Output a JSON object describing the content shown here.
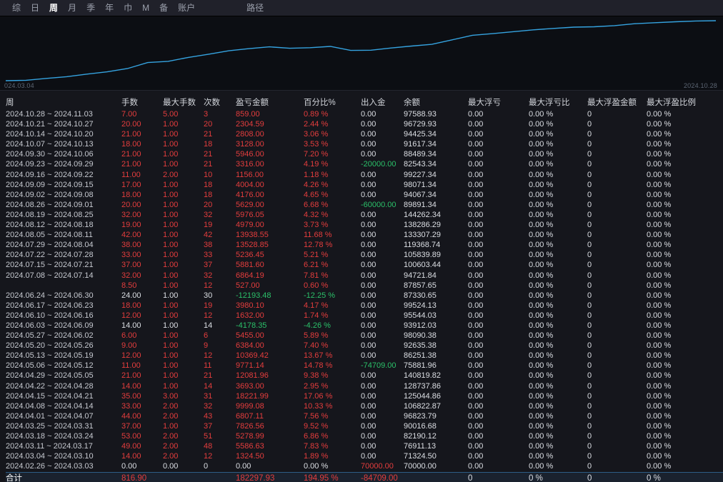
{
  "menu": {
    "items": [
      {
        "label": "综",
        "selected": false
      },
      {
        "label": "日",
        "selected": false
      },
      {
        "label": "周",
        "selected": true
      },
      {
        "label": "月",
        "selected": false
      },
      {
        "label": "季",
        "selected": false
      },
      {
        "label": "年",
        "selected": false
      },
      {
        "label": "巾",
        "selected": false
      },
      {
        "label": "M",
        "selected": false
      },
      {
        "label": "备",
        "selected": false
      },
      {
        "label": "账户",
        "selected": false
      },
      {
        "label": "路径",
        "selected": false,
        "gap_before": true
      }
    ]
  },
  "chart": {
    "left_label": "024.03.04",
    "right_label": "2024.10.28"
  },
  "chart_data": {
    "type": "line",
    "title": "",
    "x_axis_labels": [
      "024.03.04",
      "2024.10.28"
    ],
    "ylim": [
      0,
      182297.93
    ],
    "series_name": "cumulative_pnl",
    "cumulative_pnl": [
      0,
      1324.5,
      6911.13,
      12190.12,
      20016.68,
      26823.79,
      36822.87,
      55044.86,
      58737.86,
      70819.82,
      80590.96,
      90960.38,
      97344.38,
      102799.38,
      98621.03,
      100253.03,
      104233.13,
      92039.65,
      92566.65,
      99430.84,
      105312.44,
      110548.89,
      124077.74,
      138016.29,
      142995.29,
      148971.34,
      154600.34,
      158776.34,
      162780.34,
      163936.34,
      167252.34,
      173198.34,
      176326.34,
      179134.34,
      181438.93,
      182297.93
    ]
  },
  "colors": {
    "accent_line": "#35a3e0",
    "tone_map": {
      "r": "#e43d3d",
      "g": "#2bc069",
      "w": "#dcdfe4",
      "n": "#aaaeb8",
      "-": "transparent"
    }
  },
  "table": {
    "headers": [
      "周",
      "手数",
      "最大手数",
      "次数",
      "盈亏金额",
      "百分比%",
      "出入金",
      "余额",
      "最大浮亏",
      "最大浮亏比",
      "最大浮盈金额",
      "最大浮盈比例"
    ],
    "column_keys": [
      "lots",
      "max-lots",
      "times",
      "pnl",
      "pct",
      "cash-flow",
      "balance",
      "max-float-loss",
      "max-float-loss-pct",
      "max-float-profit",
      "max-float-profit-pct"
    ],
    "rows": [
      {
        "week": "2024.10.28 ~ 2024.11.03",
        "vals": [
          "7.00",
          "5.00",
          "3",
          "859.00",
          "0.89 %",
          "0.00",
          "97588.93",
          "0.00",
          "0.00 %",
          "0",
          "0.00 %"
        ],
        "tones": "rrrrrwwwwww"
      },
      {
        "week": "2024.10.21 ~ 2024.10.27",
        "vals": [
          "20.00",
          "1.00",
          "20",
          "2304.59",
          "2.44 %",
          "0.00",
          "96729.93",
          "0.00",
          "0.00 %",
          "0",
          "0.00 %"
        ],
        "tones": "rrrrrwwwwww"
      },
      {
        "week": "2024.10.14 ~ 2024.10.20",
        "vals": [
          "21.00",
          "1.00",
          "21",
          "2808.00",
          "3.06 %",
          "0.00",
          "94425.34",
          "0.00",
          "0.00 %",
          "0",
          "0.00 %"
        ],
        "tones": "rrrrrwwwwww"
      },
      {
        "week": "2024.10.07 ~ 2024.10.13",
        "vals": [
          "18.00",
          "1.00",
          "18",
          "3128.00",
          "3.53 %",
          "0.00",
          "91617.34",
          "0.00",
          "0.00 %",
          "0",
          "0.00 %"
        ],
        "tones": "rrrrrwwwwww"
      },
      {
        "week": "2024.09.30 ~ 2024.10.06",
        "vals": [
          "21.00",
          "1.00",
          "21",
          "5946.00",
          "7.20 %",
          "0.00",
          "88489.34",
          "0.00",
          "0.00 %",
          "0",
          "0.00 %"
        ],
        "tones": "rrrrrwwwwww"
      },
      {
        "week": "2024.09.23 ~ 2024.09.29",
        "vals": [
          "21.00",
          "1.00",
          "21",
          "3316.00",
          "4.19 %",
          "-20000.00",
          "82543.34",
          "0.00",
          "0.00 %",
          "0",
          "0.00 %"
        ],
        "tones": "rrrrrgwwwww"
      },
      {
        "week": "2024.09.16 ~ 2024.09.22",
        "vals": [
          "11.00",
          "2.00",
          "10",
          "1156.00",
          "1.18 %",
          "0.00",
          "99227.34",
          "0.00",
          "0.00 %",
          "0",
          "0.00 %"
        ],
        "tones": "rrrrrwwwwww"
      },
      {
        "week": "2024.09.09 ~ 2024.09.15",
        "vals": [
          "17.00",
          "1.00",
          "18",
          "4004.00",
          "4.26 %",
          "0.00",
          "98071.34",
          "0.00",
          "0.00 %",
          "0",
          "0.00 %"
        ],
        "tones": "rrrrrwwwwww"
      },
      {
        "week": "2024.09.02 ~ 2024.09.08",
        "vals": [
          "18.00",
          "1.00",
          "18",
          "4176.00",
          "4.65 %",
          "0.00",
          "94067.34",
          "0.00",
          "0.00 %",
          "0",
          "0.00 %"
        ],
        "tones": "rrrrrwwwwww"
      },
      {
        "week": "2024.08.26 ~ 2024.09.01",
        "vals": [
          "20.00",
          "1.00",
          "20",
          "5629.00",
          "6.68 %",
          "-60000.00",
          "89891.34",
          "0.00",
          "0.00 %",
          "0",
          "0.00 %"
        ],
        "tones": "rrrrrgwwwww"
      },
      {
        "week": "2024.08.19 ~ 2024.08.25",
        "vals": [
          "32.00",
          "1.00",
          "32",
          "5976.05",
          "4.32 %",
          "0.00",
          "144262.34",
          "0.00",
          "0.00 %",
          "0",
          "0.00 %"
        ],
        "tones": "rrrrrwwwwww"
      },
      {
        "week": "2024.08.12 ~ 2024.08.18",
        "vals": [
          "19.00",
          "1.00",
          "19",
          "4979.00",
          "3.73 %",
          "0.00",
          "138286.29",
          "0.00",
          "0.00 %",
          "0",
          "0.00 %"
        ],
        "tones": "rrrrrwwwwww"
      },
      {
        "week": "2024.08.05 ~ 2024.08.11",
        "vals": [
          "42.00",
          "1.00",
          "42",
          "13938.55",
          "11.68 %",
          "0.00",
          "133307.29",
          "0.00",
          "0.00 %",
          "0",
          "0.00 %"
        ],
        "tones": "rrrrrwwwwww"
      },
      {
        "week": "2024.07.29 ~ 2024.08.04",
        "vals": [
          "38.00",
          "1.00",
          "38",
          "13528.85",
          "12.78 %",
          "0.00",
          "119368.74",
          "0.00",
          "0.00 %",
          "0",
          "0.00 %"
        ],
        "tones": "rrrrrwwwwww"
      },
      {
        "week": "2024.07.22 ~ 2024.07.28",
        "vals": [
          "33.00",
          "1.00",
          "33",
          "5236.45",
          "5.21 %",
          "0.00",
          "105839.89",
          "0.00",
          "0.00 %",
          "0",
          "0.00 %"
        ],
        "tones": "rrrrrwwwwww"
      },
      {
        "week": "2024.07.15 ~ 2024.07.21",
        "vals": [
          "37.00",
          "1.00",
          "37",
          "5881.60",
          "6.21 %",
          "0.00",
          "100603.44",
          "0.00",
          "0.00 %",
          "0",
          "0.00 %"
        ],
        "tones": "rrrrrwwwwww"
      },
      {
        "week": "2024.07.08 ~ 2024.07.14",
        "vals": [
          "32.00",
          "1.00",
          "32",
          "6864.19",
          "7.81 %",
          "0.00",
          "94721.84",
          "0.00",
          "0.00 %",
          "0",
          "0.00 %"
        ],
        "tones": "rrrrrwwwwww"
      },
      {
        "week": "",
        "vals": [
          "8.50",
          "1.00",
          "12",
          "527.00",
          "0.60 %",
          "0.00",
          "87857.65",
          "0.00",
          "0.00 %",
          "0",
          "0.00 %"
        ],
        "tones": "rrrrrwwwwww"
      },
      {
        "week": "2024.06.24 ~ 2024.06.30",
        "vals": [
          "24.00",
          "1.00",
          "30",
          "-12193.48",
          "-12.25 %",
          "0.00",
          "87330.65",
          "0.00",
          "0.00 %",
          "0",
          "0.00 %"
        ],
        "tones": "wwwggwwwwww"
      },
      {
        "week": "2024.06.17 ~ 2024.06.23",
        "vals": [
          "18.00",
          "1.00",
          "19",
          "3980.10",
          "4.17 %",
          "0.00",
          "99524.13",
          "0.00",
          "0.00 %",
          "0",
          "0.00 %"
        ],
        "tones": "rrrrrwwwwww"
      },
      {
        "week": "2024.06.10 ~ 2024.06.16",
        "vals": [
          "12.00",
          "1.00",
          "12",
          "1632.00",
          "1.74 %",
          "0.00",
          "95544.03",
          "0.00",
          "0.00 %",
          "0",
          "0.00 %"
        ],
        "tones": "rrrrrwwwwww"
      },
      {
        "week": "2024.06.03 ~ 2024.06.09",
        "vals": [
          "14.00",
          "1.00",
          "14",
          "-4178.35",
          "-4.26 %",
          "0.00",
          "93912.03",
          "0.00",
          "0.00 %",
          "0",
          "0.00 %"
        ],
        "tones": "wwwggwwwwww"
      },
      {
        "week": "2024.05.27 ~ 2024.06.02",
        "vals": [
          "6.00",
          "1.00",
          "6",
          "5455.00",
          "5.89 %",
          "0.00",
          "98090.38",
          "0.00",
          "0.00 %",
          "0",
          "0.00 %"
        ],
        "tones": "rrrrrwwwwww"
      },
      {
        "week": "2024.05.20 ~ 2024.05.26",
        "vals": [
          "9.00",
          "1.00",
          "9",
          "6384.00",
          "7.40 %",
          "0.00",
          "92635.38",
          "0.00",
          "0.00 %",
          "0",
          "0.00 %"
        ],
        "tones": "rrrrrwwwwww"
      },
      {
        "week": "2024.05.13 ~ 2024.05.19",
        "vals": [
          "12.00",
          "1.00",
          "12",
          "10369.42",
          "13.67 %",
          "0.00",
          "86251.38",
          "0.00",
          "0.00 %",
          "0",
          "0.00 %"
        ],
        "tones": "rrrrrwwwwww"
      },
      {
        "week": "2024.05.06 ~ 2024.05.12",
        "vals": [
          "11.00",
          "1.00",
          "11",
          "9771.14",
          "14.78 %",
          "-74709.00",
          "75881.96",
          "0.00",
          "0.00 %",
          "0",
          "0.00 %"
        ],
        "tones": "rrrrrgwwwww"
      },
      {
        "week": "2024.04.29 ~ 2024.05.05",
        "vals": [
          "21.00",
          "1.00",
          "21",
          "12081.96",
          "9.38 %",
          "0.00",
          "140819.82",
          "0.00",
          "0.00 %",
          "0",
          "0.00 %"
        ],
        "tones": "rrrrrwwwwww"
      },
      {
        "week": "2024.04.22 ~ 2024.04.28",
        "vals": [
          "14.00",
          "1.00",
          "14",
          "3693.00",
          "2.95 %",
          "0.00",
          "128737.86",
          "0.00",
          "0.00 %",
          "0",
          "0.00 %"
        ],
        "tones": "rrrrrwwwwww"
      },
      {
        "week": "2024.04.15 ~ 2024.04.21",
        "vals": [
          "35.00",
          "3.00",
          "31",
          "18221.99",
          "17.06 %",
          "0.00",
          "125044.86",
          "0.00",
          "0.00 %",
          "0",
          "0.00 %"
        ],
        "tones": "rrrrrwwwwww"
      },
      {
        "week": "2024.04.08 ~ 2024.04.14",
        "vals": [
          "33.00",
          "2.00",
          "32",
          "9999.08",
          "10.33 %",
          "0.00",
          "106822.87",
          "0.00",
          "0.00 %",
          "0",
          "0.00 %"
        ],
        "tones": "rrrrrwwwwww"
      },
      {
        "week": "2024.04.01 ~ 2024.04.07",
        "vals": [
          "44.00",
          "2.00",
          "43",
          "6807.11",
          "7.56 %",
          "0.00",
          "96823.79",
          "0.00",
          "0.00 %",
          "0",
          "0.00 %"
        ],
        "tones": "rrrrrwwwwww"
      },
      {
        "week": "2024.03.25 ~ 2024.03.31",
        "vals": [
          "37.00",
          "1.00",
          "37",
          "7826.56",
          "9.52 %",
          "0.00",
          "90016.68",
          "0.00",
          "0.00 %",
          "0",
          "0.00 %"
        ],
        "tones": "rrrrrwwwwww"
      },
      {
        "week": "2024.03.18 ~ 2024.03.24",
        "vals": [
          "53.00",
          "2.00",
          "51",
          "5278.99",
          "6.86 %",
          "0.00",
          "82190.12",
          "0.00",
          "0.00 %",
          "0",
          "0.00 %"
        ],
        "tones": "rrrrrwwwwww"
      },
      {
        "week": "2024.03.11 ~ 2024.03.17",
        "vals": [
          "49.00",
          "2.00",
          "48",
          "5586.63",
          "7.83 %",
          "0.00",
          "76911.13",
          "0.00",
          "0.00 %",
          "0",
          "0.00 %"
        ],
        "tones": "rrrrrwwwwww"
      },
      {
        "week": "2024.03.04 ~ 2024.03.10",
        "vals": [
          "14.00",
          "2.00",
          "12",
          "1324.50",
          "1.89 %",
          "0.00",
          "71324.50",
          "0.00",
          "0.00 %",
          "0",
          "0.00 %"
        ],
        "tones": "rrrrrwwwwww"
      },
      {
        "week": "2024.02.26 ~ 2024.03.03",
        "vals": [
          "0.00",
          "0.00",
          "0",
          "0.00",
          "0.00 %",
          "70000.00",
          "70000.00",
          "0.00",
          "0.00 %",
          "0",
          "0.00 %"
        ],
        "tones": "wwwwwrwwwww"
      }
    ],
    "total_row": {
      "week": "合计",
      "vals": [
        "816.90",
        "",
        "",
        "182297.93",
        "194.95 %",
        "-84709.00",
        "",
        "0",
        "0 %",
        "0",
        "0 %"
      ],
      "tones": "r--rrr-wwww"
    }
  }
}
